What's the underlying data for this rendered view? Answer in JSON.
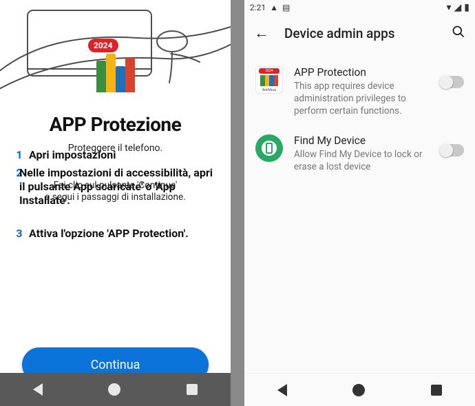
{
  "left": {
    "badge_year": "2024",
    "app_title": "APP Protezione",
    "subtitle": "Proteggere il telefono.",
    "steps": [
      {
        "num": "1",
        "text": "Apri impostazioni"
      },
      {
        "num": "2",
        "text": "Nelle impostazioni di accessibilità, apri il pulsante App scaricate' o 'App Installate'."
      },
      {
        "num": "3",
        "text": "Attiva l'opzione 'APP Protection'."
      }
    ],
    "overlay_a": "Fai clic sul pulsante 'Continua'",
    "overlay_b": "e segui i passaggi di installazione.",
    "continue_label": "Continua"
  },
  "right": {
    "status_time": "2:21",
    "app_bar_title": "Device admin apps",
    "items": [
      {
        "title": "APP Protection",
        "desc": "This app requires device administration privileges to perform certain functions.",
        "icon": "app-protection-icon",
        "enabled": false
      },
      {
        "title": "Find My Device",
        "desc": "Allow Find My Device to lock or erase a lost device",
        "icon": "find-my-device-icon",
        "enabled": false
      }
    ]
  }
}
